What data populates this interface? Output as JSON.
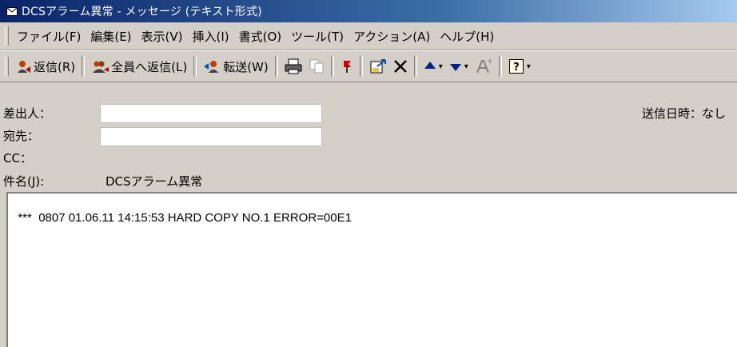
{
  "window": {
    "title": "DCSアラーム異常 - メッセージ (テキスト形式)"
  },
  "menu": [
    "ファイル(F)",
    "編集(E)",
    "表示(V)",
    "挿入(I)",
    "書式(O)",
    "ツール(T)",
    "アクション(A)",
    "ヘルプ(H)"
  ],
  "toolbar": {
    "reply_label": "返信(R)",
    "reply_all_label": "全員へ返信(L)",
    "forward_label": "転送(W)"
  },
  "headers": {
    "from_label": "差出人：",
    "from_value": "",
    "to_label": "宛先：",
    "to_value": "",
    "cc_label": "CC：",
    "subject_label": "件名(J):",
    "subject_value": "DCSアラーム異常",
    "sent_label": "送信日時：",
    "sent_value": "なし"
  },
  "message": {
    "body": "***  0807 01.06.11 14:15:53 HARD COPY NO.1 ERROR=00E1"
  },
  "colors": {
    "titlebar_start": "#0a246a",
    "chrome": "#d4d0c8",
    "body_bg": "#ffffff"
  }
}
